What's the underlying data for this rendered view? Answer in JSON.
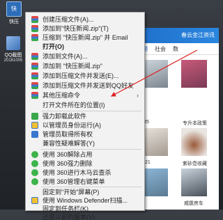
{
  "desktop": {
    "icon1": {
      "label": "快压",
      "glyph": "快"
    },
    "icon2": {
      "label": "QQ截图",
      "sub": "20161005"
    }
  },
  "browser": {
    "title": "春云金江资讯",
    "nav": [
      "频",
      "社会",
      "数"
    ],
    "captions": [
      "专升本政策",
      "紫砂壶收藏",
      "威霆房车"
    ],
    "side_labels": [
      "t5",
      "21"
    ]
  },
  "menu": {
    "items": [
      {
        "label": "创建压缩文件(A)...",
        "icon": "zip"
      },
      {
        "label": "添加到\"快压新闻.zip\"(T)",
        "icon": "zip"
      },
      {
        "label": "压缩到 \"快压新闻.zip\" 并 Email",
        "icon": "zip"
      },
      {
        "label": "打开(O)",
        "icon": "",
        "bold": true
      },
      {
        "label": "添加到文件(A)...",
        "icon": "zip"
      },
      {
        "label": "添加到 \"快压新闻.zip\"",
        "icon": "zip"
      },
      {
        "label": "添加到压缩文件并发送(E)...",
        "icon": "zip"
      },
      {
        "label": "添加到压缩文件并发送到QQ好友",
        "icon": "zip"
      },
      {
        "label": "其他压缩命令",
        "icon": "zip",
        "sub": true
      },
      {
        "label": "打开文件所在的位置(I)",
        "icon": ""
      },
      {
        "label": "强力卸载此软件",
        "icon": "green"
      },
      {
        "label": "以管理员身份运行(A)",
        "icon": "shield"
      },
      {
        "label": "管理员取得所有权",
        "icon": "blue"
      },
      {
        "label": "兼容性疑难解答(Y)",
        "icon": ""
      },
      {
        "label": "使用 360解除占用",
        "icon": "q360"
      },
      {
        "label": "使用 360强力删除",
        "icon": "q360"
      },
      {
        "label": "使用 360进行木马云查杀",
        "icon": "q360"
      },
      {
        "label": "使用 360管理右键菜单",
        "icon": "q360"
      },
      {
        "label": "固定到\"开始\"屏幕(P)",
        "icon": ""
      },
      {
        "label": "使用 Windows Defender扫描...",
        "icon": "shield"
      },
      {
        "label": "固定到任务栏(K)",
        "icon": ""
      },
      {
        "label": "还原以前的版本(V)",
        "icon": ""
      }
    ]
  }
}
